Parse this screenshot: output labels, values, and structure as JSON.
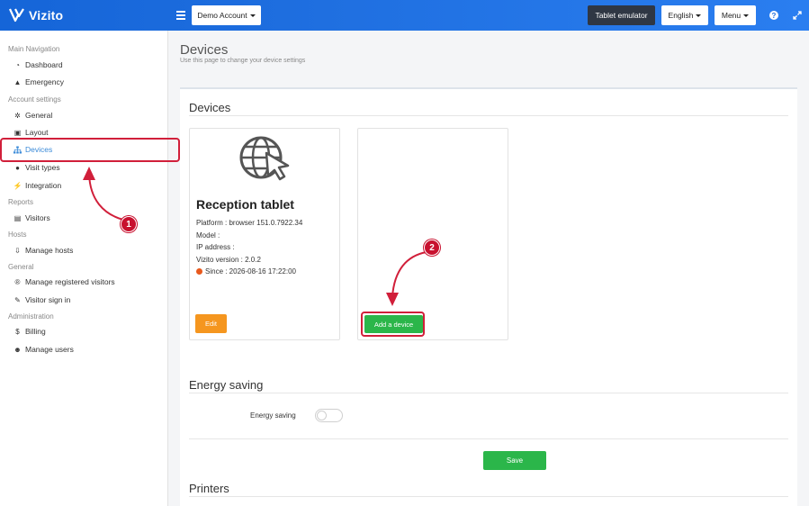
{
  "topbar": {
    "brand": "Vizito",
    "account_label": "Demo Account",
    "tablet_emulator_label": "Tablet emulator",
    "language_label": "English",
    "menu_label": "Menu",
    "help_glyph": "?"
  },
  "sidebar": {
    "sections": [
      {
        "title": "Main Navigation",
        "items": [
          {
            "label": "Dashboard",
            "icon": "dashboard-icon"
          },
          {
            "label": "Emergency",
            "icon": "warning-icon"
          }
        ]
      },
      {
        "title": "Account settings",
        "items": [
          {
            "label": "General",
            "icon": "gear-icon"
          },
          {
            "label": "Layout",
            "icon": "image-icon"
          },
          {
            "label": "Devices",
            "icon": "sitemap-icon",
            "active": true
          },
          {
            "label": "Visit types",
            "icon": "users-icon"
          },
          {
            "label": "Integration",
            "icon": "plug-icon"
          }
        ]
      },
      {
        "title": "Reports",
        "items": [
          {
            "label": "Visitors",
            "icon": "book-icon"
          }
        ]
      },
      {
        "title": "Hosts",
        "items": [
          {
            "label": "Manage hosts",
            "icon": "download-icon"
          }
        ]
      },
      {
        "title": "General",
        "items": [
          {
            "label": "Manage registered visitors",
            "icon": "registered-icon"
          },
          {
            "label": "Visitor sign in",
            "icon": "pencil-icon"
          }
        ]
      },
      {
        "title": "Administration",
        "items": [
          {
            "label": "Billing",
            "icon": "dollar-icon"
          },
          {
            "label": "Manage users",
            "icon": "user-plus-icon"
          }
        ]
      }
    ]
  },
  "page": {
    "title": "Devices",
    "subtitle": "Use this page to change your device settings"
  },
  "devices_section": {
    "heading": "Devices",
    "device": {
      "name": "Reception tablet",
      "platform": "Platform : browser 151.0.7922.34",
      "model": "Model :",
      "ip": "IP address :",
      "version": "Vizito version : 2.0.2",
      "since": "Since : 2026-08-16 17:22:00",
      "status_color": "#e8591d",
      "edit_label": "Edit"
    },
    "add_device_label": "Add a device"
  },
  "energy_section": {
    "heading": "Energy saving",
    "toggle_label": "Energy saving",
    "toggle_on": false,
    "save_label": "Save"
  },
  "printers_section": {
    "heading": "Printers"
  },
  "annotations": {
    "step1": "1",
    "step2": "2",
    "color": "#d11f3a"
  }
}
